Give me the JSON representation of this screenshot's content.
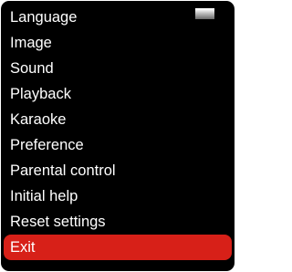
{
  "menu": {
    "items": [
      {
        "label": "Language"
      },
      {
        "label": "Image"
      },
      {
        "label": "Sound"
      },
      {
        "label": "Playback"
      },
      {
        "label": "Karaoke"
      },
      {
        "label": "Preference"
      },
      {
        "label": "Parental control"
      },
      {
        "label": "Initial help"
      },
      {
        "label": "Reset settings"
      },
      {
        "label": "Exit"
      }
    ],
    "selected_label": "Exit",
    "colors": {
      "background": "#000000",
      "text": "#ffffff",
      "selected": "#d72018"
    },
    "scroll_indicator_icon": "scrollbar-thumb-icon"
  }
}
